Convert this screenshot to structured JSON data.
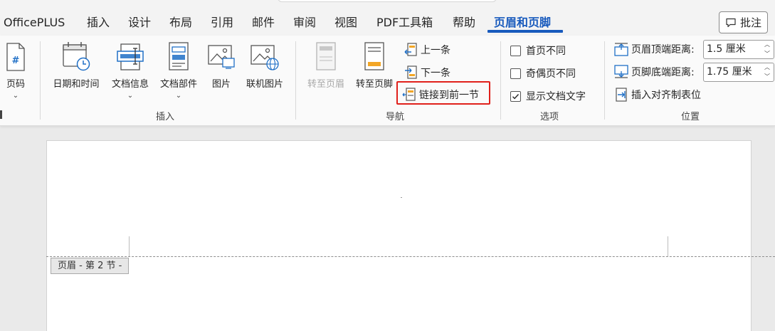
{
  "tabs": [
    {
      "label": "OfficePLUS"
    },
    {
      "label": "插入"
    },
    {
      "label": "设计"
    },
    {
      "label": "布局"
    },
    {
      "label": "引用"
    },
    {
      "label": "邮件"
    },
    {
      "label": "审阅"
    },
    {
      "label": "视图"
    },
    {
      "label": "PDF工具箱"
    },
    {
      "label": "帮助"
    },
    {
      "label": "页眉和页脚"
    }
  ],
  "comment_button": {
    "label": "批注"
  },
  "groups": {
    "header_footer": {
      "page_number_label": "页码"
    },
    "insert": {
      "label": "插入",
      "date_time": "日期和时间",
      "doc_info": "文档信息",
      "doc_parts": "文档部件",
      "picture": "图片",
      "online_picture": "联机图片"
    },
    "navigation": {
      "label": "导航",
      "goto_header": "转至页眉",
      "goto_footer": "转至页脚",
      "previous": "上一条",
      "next": "下一条",
      "link_to_previous": "链接到前一节"
    },
    "options": {
      "label": "选项",
      "different_first_page": "首页不同",
      "different_odd_even": "奇偶页不同",
      "show_document_text": "显示文档文字",
      "different_first_page_checked": false,
      "different_odd_even_checked": false,
      "show_document_text_checked": true
    },
    "position": {
      "label": "位置",
      "header_from_top_label": "页眉顶端距离:",
      "header_from_top_value": "1.5 厘米",
      "footer_from_bottom_label": "页脚底端距离:",
      "footer_from_bottom_value": "1.75 厘米",
      "insert_alignment_tab": "插入对齐制表位"
    }
  },
  "document": {
    "header_tag": "页眉 - 第 2 节 -"
  },
  "colors": {
    "accent": "#185abd",
    "highlight_box": "#e0201b"
  }
}
